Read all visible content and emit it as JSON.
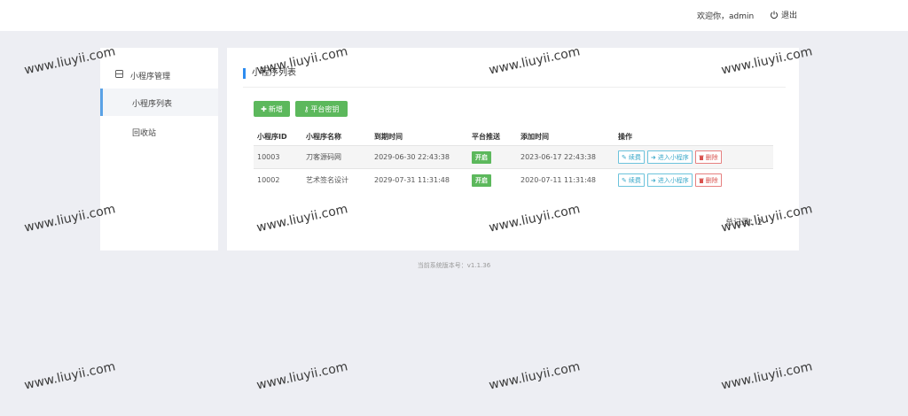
{
  "header": {
    "welcome": "欢迎你，admin",
    "logout": "退出"
  },
  "sidebar": {
    "group_label": "小程序管理",
    "items": [
      {
        "label": "小程序列表",
        "active": true
      },
      {
        "label": "回收站",
        "active": false
      }
    ]
  },
  "main": {
    "title": "小程序列表",
    "buttons": {
      "add": "新增",
      "platform_key": "平台密钥"
    },
    "table": {
      "columns": [
        "小程序ID",
        "小程序名称",
        "到期时间",
        "平台推送",
        "添加时间",
        "操作"
      ],
      "rows": [
        {
          "id": "10003",
          "name": "刀客源码网",
          "expire": "2029-06-30 22:43:38",
          "push": "开启",
          "added": "2023-06-17 22:43:38"
        },
        {
          "id": "10002",
          "name": "艺术签名设计",
          "expire": "2029-07-31 11:31:48",
          "push": "开启",
          "added": "2020-07-11 11:31:48"
        }
      ],
      "actions": {
        "renew": "续费",
        "enter": "进入小程序",
        "delete": "删除"
      }
    },
    "total": "总记录：2"
  },
  "footer": "当前系统版本号：v1.1.36",
  "watermark": "www.liuyii.com",
  "colors": {
    "green": "#5cb85c",
    "accent_blue": "#2d8cf0",
    "action_blue": "#3aa8c9",
    "danger": "#d9534f"
  }
}
